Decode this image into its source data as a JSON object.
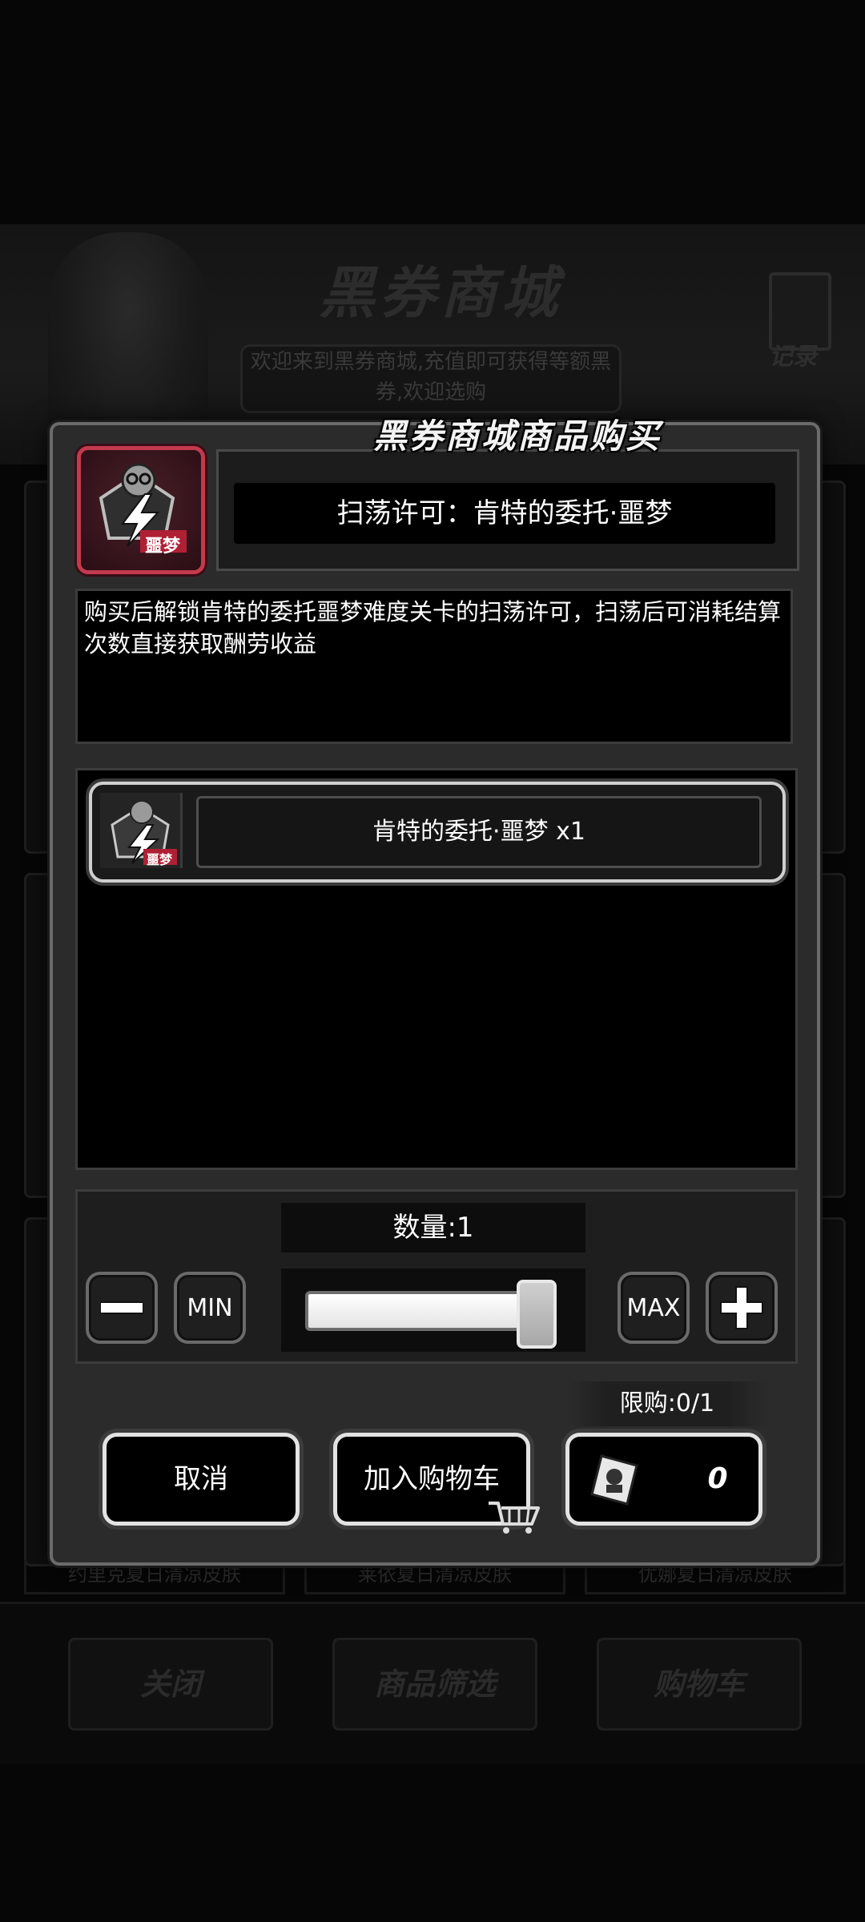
{
  "background": {
    "shop_title": "黑券商城",
    "welcome_text": "欢迎来到黑券商城,充值即可获得等额黑券,欢迎选购",
    "record_label": "记录",
    "item_names": [
      "约里克夏日清凉皮肤",
      "莱依夏日清凉皮肤",
      "优娜夏日清凉皮肤"
    ],
    "bottom_buttons": [
      "关闭",
      "商品筛选",
      "购物车"
    ]
  },
  "modal": {
    "title": "黑券商城商品购买",
    "product_name": "扫荡许可：肯特的委托·噩梦",
    "item_badge": "噩梦",
    "description": "购买后解锁肯特的委托噩梦难度关卡的扫荡许可，扫荡后可消耗结算次数直接获取酬劳收益",
    "reward": {
      "label": "肯特的委托·噩梦 x1",
      "badge": "噩梦"
    },
    "quantity": {
      "label": "数量:1",
      "value": 1,
      "max": 1,
      "min_label": "MIN",
      "max_label": "MAX"
    },
    "limit_label": "限购:0/1",
    "buttons": {
      "cancel": "取消",
      "add_to_cart": "加入购物车",
      "price": "0"
    }
  },
  "colors": {
    "accent_red": "#c23a4e",
    "panel": "#2b2b2b",
    "border_light": "#e3e3e3"
  }
}
